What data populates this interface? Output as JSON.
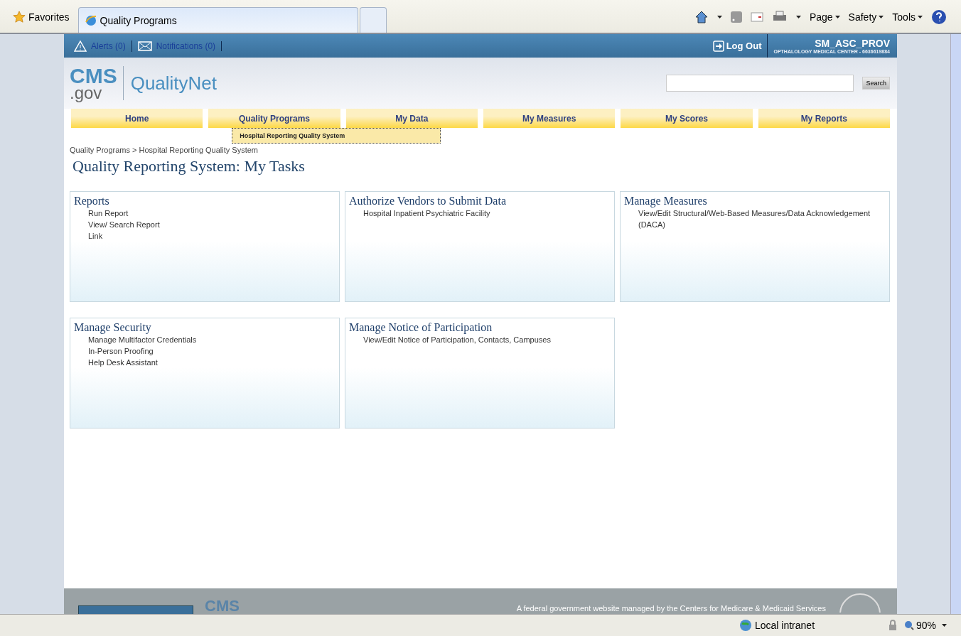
{
  "browser": {
    "favorites": "Favorites",
    "tabs": [
      {
        "title": "Quality Programs",
        "selected": true
      },
      {
        "selected": false
      }
    ],
    "menus": [
      "Page",
      "Safety",
      "Tools"
    ]
  },
  "top_bar": {
    "alerts": "Alerts (0)",
    "notifications": "Notifications (0)",
    "logout": "Log Out",
    "user": "SM_ASC_PROV",
    "organization": "OPTHALOLOGY MEDICAL CENTER - 6636619884"
  },
  "header": {
    "logo_top": "CMS",
    "logo_bottom": ".gov",
    "site_name": "QualityNet",
    "search_button": "Search"
  },
  "nav": {
    "items": [
      {
        "label": "Home"
      },
      {
        "label": "Quality Programs",
        "submenu": [
          "Hospital Reporting Quality System"
        ]
      },
      {
        "label": "My Data"
      },
      {
        "label": "My Measures"
      },
      {
        "label": "My Scores"
      },
      {
        "label": "My Reports"
      }
    ]
  },
  "breadcrumb": "Quality Programs > Hospital Reporting Quality System",
  "page_title": "Quality Reporting System: My Tasks",
  "cards": [
    {
      "title": "Reports",
      "links": [
        "Run Report",
        "View/ Search Report",
        "Link"
      ]
    },
    {
      "title": "Authorize Vendors to Submit Data",
      "links": [
        "Hospital Inpatient Psychiatric Facility"
      ]
    },
    {
      "title": "Manage Measures",
      "links": [
        "View/Edit Structural/Web-Based Measures/Data Acknowledgement (DACA)"
      ]
    },
    {
      "title": "Manage Security",
      "links": [
        "Manage Multifactor Credentials",
        "In-Person Proofing",
        "Help Desk Assistant"
      ]
    },
    {
      "title": "Manage Notice of Participation",
      "links": [
        "View/Edit Notice of Participation, Contacts, Campuses"
      ]
    }
  ],
  "footer": {
    "logo": "CMS",
    "text": "A federal government website managed by the Centers for Medicare & Medicaid Services"
  },
  "status_bar": {
    "zone": "Local intranet",
    "zoom": "90%"
  }
}
